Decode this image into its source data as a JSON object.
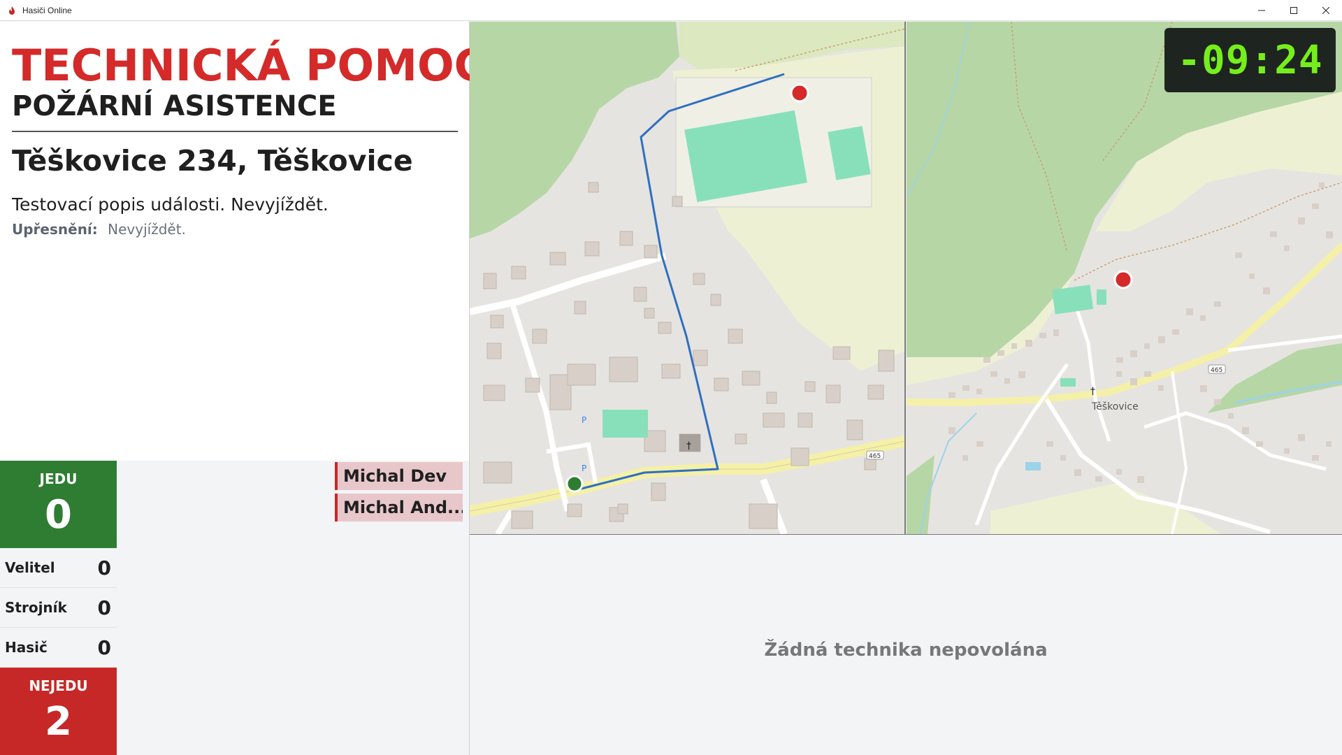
{
  "window": {
    "title": "Hasiči Online"
  },
  "event": {
    "type": "TECHNICKÁ POMOC",
    "subtype": "POŽÁRNÍ ASISTENCE",
    "address": "Těškovice 234, Těškovice",
    "description": "Testovací popis události. Nevyjíždět.",
    "detail_label": "Upřesnění:",
    "detail_value": "Nevyjíždět."
  },
  "response": {
    "going_label": "JEDU",
    "going_count": "0",
    "roles": [
      {
        "name": "Velitel",
        "count": "0"
      },
      {
        "name": "Strojník",
        "count": "0"
      },
      {
        "name": "Hasič",
        "count": "0"
      }
    ],
    "not_going_label": "NEJEDU",
    "not_going_count": "2",
    "not_going_members": [
      "Michal Dev",
      "Michal And..."
    ]
  },
  "map": {
    "place_label": "Těškovice",
    "road_number": "465"
  },
  "timer": {
    "value": "-09:24"
  },
  "vehicles": {
    "empty_text": "Žádná technika nepovolána"
  },
  "colors": {
    "accent_red": "#d42a2a",
    "going_green": "#2e7d32",
    "not_going_red": "#c62828",
    "timer_green": "#76ee1c",
    "route_blue": "#2f6fc0"
  }
}
